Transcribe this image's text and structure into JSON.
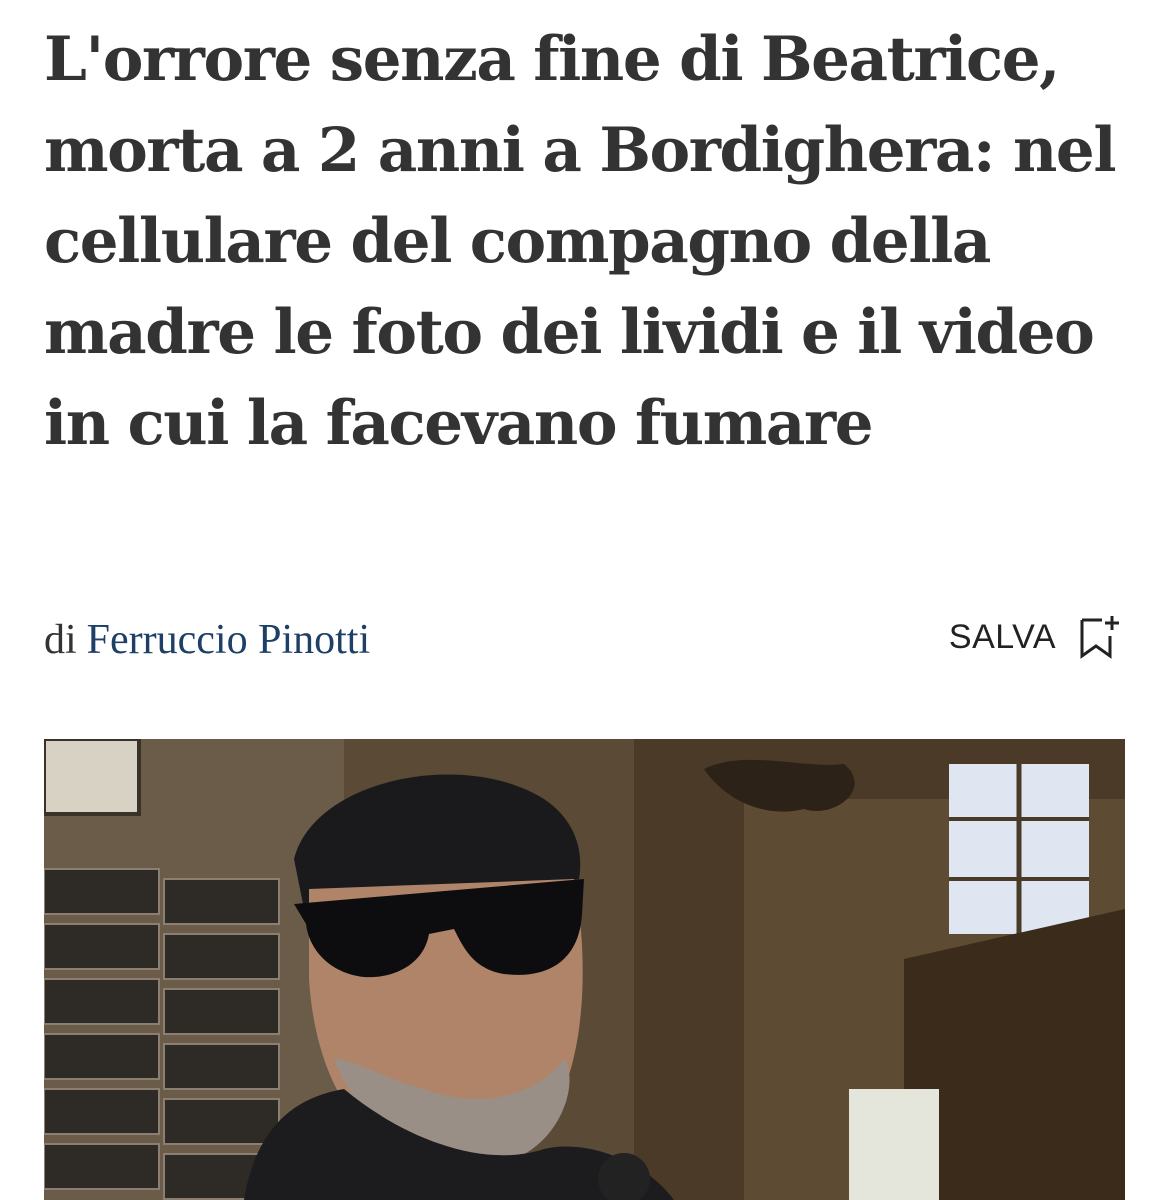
{
  "article": {
    "headline": "L'orrore senza fine di Beatrice, morta a 2 anni a Bordighera: nel cellulare del compagno della madre le foto dei lividi e il video in cui la facevano fumare",
    "byline_prefix": "di",
    "author": "Ferruccio Pinotti",
    "save_label": "SALVA",
    "save_icon": "bookmark-add-icon"
  },
  "colors": {
    "headline": "#333333",
    "author_link": "#1e3f66",
    "text": "#222222"
  }
}
